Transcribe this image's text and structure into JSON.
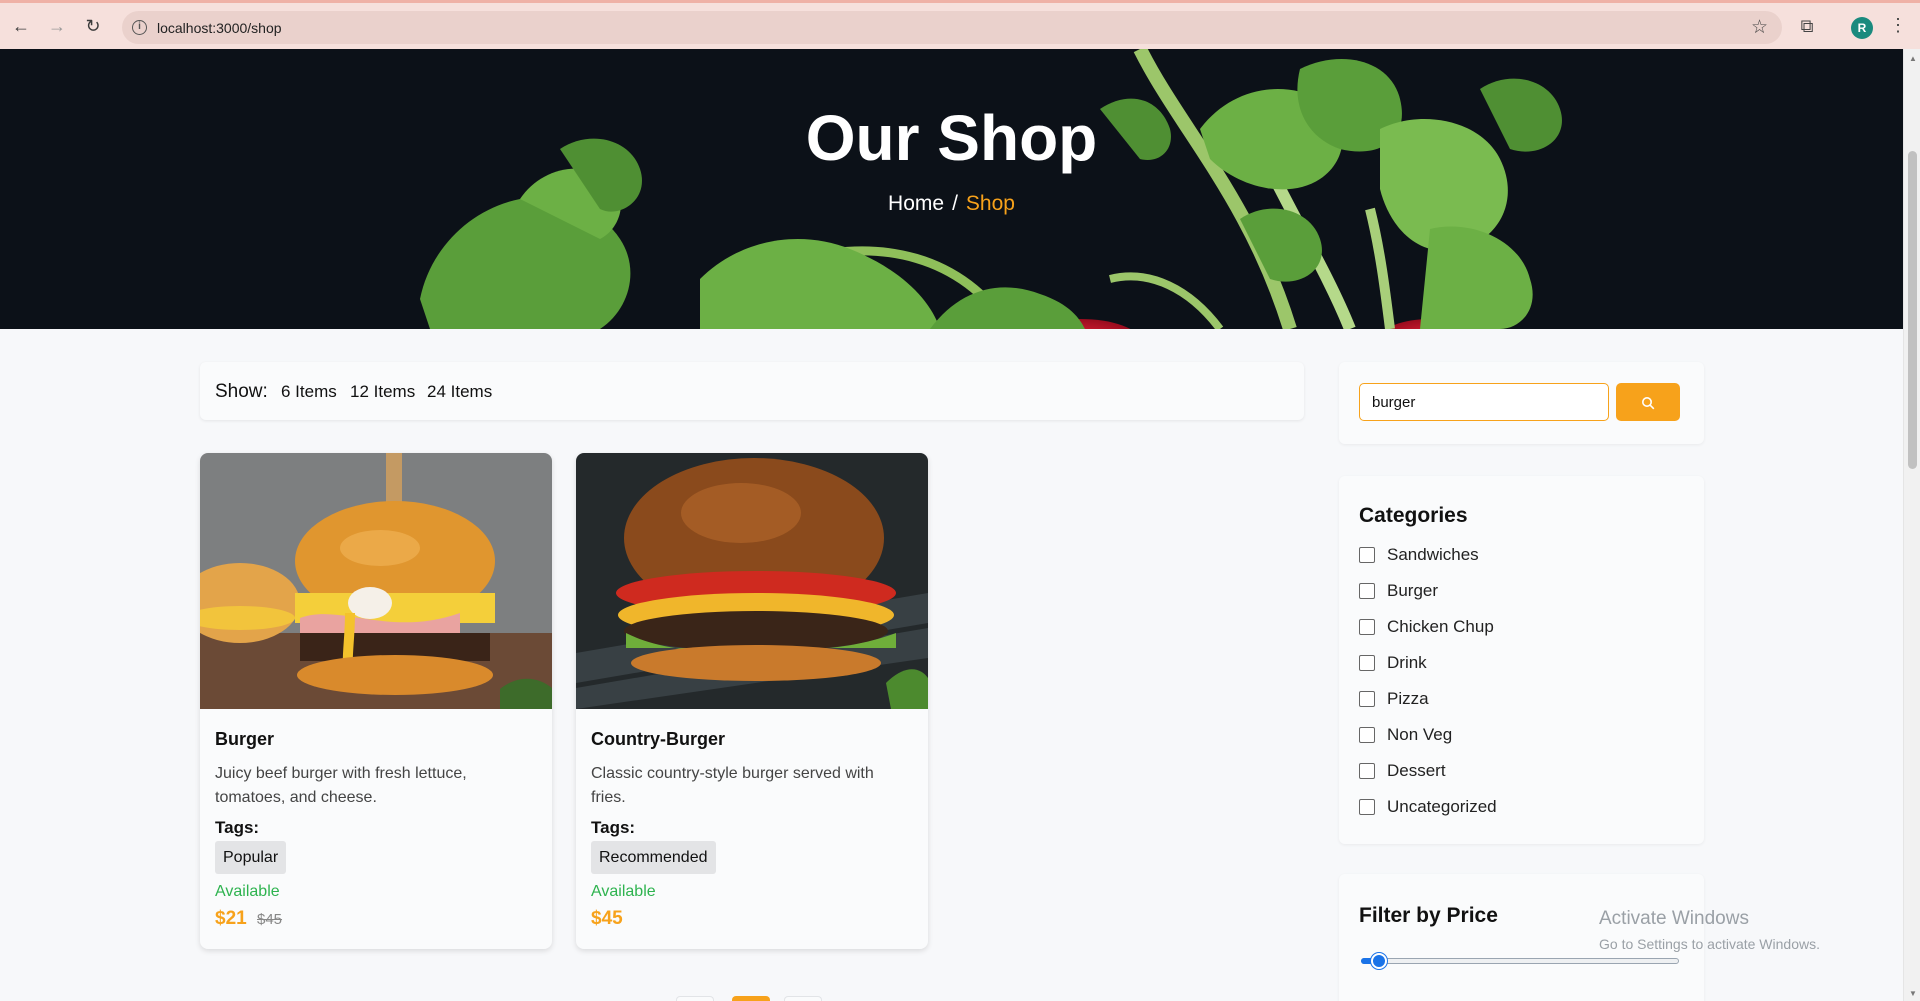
{
  "browser": {
    "url": "localhost:3000/shop",
    "avatar_letter": "R",
    "icons": [
      "back-icon",
      "forward-icon",
      "reload-icon",
      "info-icon",
      "star-icon",
      "extensions-icon",
      "menu-icon"
    ]
  },
  "hero": {
    "title": "Our Shop",
    "breadcrumb": {
      "home": "Home",
      "separator": "/",
      "current": "Shop"
    }
  },
  "show_bar": {
    "label": "Show:",
    "options": [
      "6 Items",
      "12 Items",
      "24 Items"
    ]
  },
  "products": [
    {
      "name": "Burger",
      "description": "Juicy beef burger with fresh lettuce, tomatoes, and cheese.",
      "tags_label": "Tags:",
      "tag": "Popular",
      "availability": "Available",
      "price": "$21",
      "old_price": "$45"
    },
    {
      "name": "Country-Burger",
      "description": "Classic country-style burger served with fries.",
      "tags_label": "Tags:",
      "tag": "Recommended",
      "availability": "Available",
      "price": "$45",
      "old_price": ""
    }
  ],
  "search": {
    "value": "burger",
    "button_icon": "search-icon"
  },
  "categories": {
    "title": "Categories",
    "items": [
      "Sandwiches",
      "Burger",
      "Chicken Chup",
      "Drink",
      "Pizza",
      "Non Veg",
      "Dessert",
      "Uncategorized"
    ]
  },
  "price_filter": {
    "title": "Filter by Price",
    "slider_fraction": 0.03
  },
  "watermark": {
    "line1": "Activate Windows",
    "line2": "Go to Settings to activate Windows."
  },
  "colors": {
    "accent": "#f7a21b",
    "available": "#2eb34f",
    "hero_bg": "#0c1118"
  }
}
